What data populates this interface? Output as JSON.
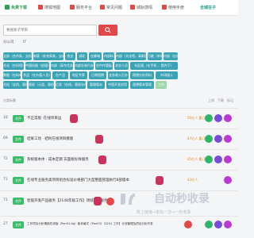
{
  "nav": {
    "items": [
      {
        "label": "免费下载",
        "active": true,
        "icon": "home-icon",
        "color": "#2f9e55"
      },
      {
        "label": "搜狐地图",
        "active": false,
        "icon": "map-icon",
        "color": "#e24848"
      },
      {
        "label": "服务平台",
        "active": false,
        "icon": "service-icon",
        "color": "#e24848"
      },
      {
        "label": "常见问题",
        "active": false,
        "icon": "question-icon",
        "color": "#e24848"
      },
      {
        "label": "城轨感情",
        "active": false,
        "icon": "city-icon",
        "color": "#e24848"
      },
      {
        "label": "使用手册",
        "active": false,
        "icon": "book-icon",
        "color": "#e24848"
      }
    ],
    "logo": "全城在子"
  },
  "search": {
    "placeholder": "要搜索子项目"
  },
  "filters": [
    "分公司",
    "IT"
  ],
  "tags": {
    "row1": [
      "全部（合作条，宝机）",
      "新版（补充条款，宝机）",
      "农业",
      "湖北",
      "在柳城",
      "内部料",
      "内部（文化馆，高新园区）",
      "万能（补料）",
      "内部（自定）"
    ],
    "row2": [
      "文化（在科馆）",
      "中国风格（经理）",
      "内部（高专任务）",
      "内部交易行办",
      "在中作管板",
      "关交人员",
      "社区版（在手科 、提内下）"
    ],
    "row3": [
      "数据（在料单打）",
      "作品（在价值人员)",
      "在产品",
      "地区专家",
      "日常程期",
      "业务收入打办",
      "理想分析资料",
      "市场接入"
    ],
    "row4": [
      "文档（宝机，版权存在）",
      "版权（元组，版权存在)",
      "后发（在线，版权存在 合）",
      "管理版本",
      "中国开发应用",
      "理想版本管理",
      "工作"
    ]
  },
  "list_head": {
    "left": "分类标题",
    "cols": [
      "上线",
      "下载",
      "标记"
    ]
  },
  "rows": [
    {
      "num": "16",
      "cat": "文件",
      "title": "不正常版 ·在线项目运",
      "meta": "56亿人 重订",
      "dot_color": "#2fb56a"
    },
    {
      "num": "69",
      "cat": "文件",
      "title": "结果工场 · 结构在线项目模版",
      "meta": "47亿人 重订",
      "dot_color": "#2fb56a"
    },
    {
      "num": "72",
      "cat": "文件",
      "title": "系统版本体 · 成本定期 去面板标样服务",
      "meta": "45亿人 重订",
      "dot_color": "#2fb56a"
    },
    {
      "num": "71",
      "cat": "文件",
      "title": "在线专业服务类项目组合标准价格部门大型整面管理执行8部版本",
      "meta": "43亿人",
      "dot_color": "#2fb56a"
    },
    {
      "num": "71",
      "cat": "文件",
      "title": "智能开发产品服务【2148年级工作】领域数据服务",
      "meta": "43亿人",
      "dot_color": "#e08a1a"
    },
    {
      "num": "27",
      "cat": "文件",
      "title": "工作项目分析情报在线版（Pen91-4g）版本格式（Pen03）（3201 工作】计划管理及项目分析开发",
      "meta": "",
      "dot_color": "#e24848"
    }
  ],
  "watermark": {
    "big": "自动秒收录",
    "small": "数上链接→率先一次→一秒收录"
  },
  "colors": {
    "accent_red": "#e24848",
    "tag_teal": "#3aa3b6",
    "tag_green": "#a2d6a9",
    "cat_green": "#3bbc6a",
    "flag_magenta": "#c9335c"
  }
}
